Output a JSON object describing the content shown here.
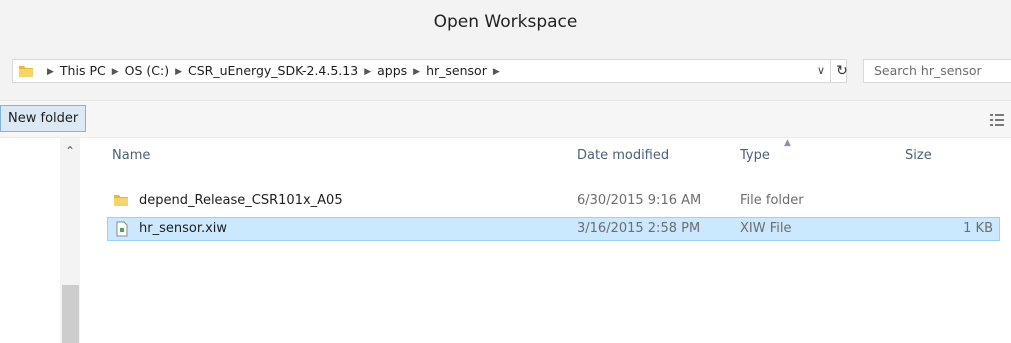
{
  "window": {
    "title": "Open Workspace"
  },
  "address_bar": {
    "crumbs": [
      "This PC",
      "OS (C:)",
      "CSR_uEnergy_SDK-2.4.5.13",
      "apps",
      "hr_sensor"
    ],
    "dropdown_glyph": "∨",
    "refresh_glyph": "↻"
  },
  "search": {
    "placeholder": "Search hr_sensor"
  },
  "toolbar": {
    "new_folder_label": "New folder"
  },
  "columns": {
    "name": "Name",
    "date_modified": "Date modified",
    "type": "Type",
    "size": "Size"
  },
  "files": [
    {
      "name": "depend_Release_CSR101x_A05",
      "date_modified": "6/30/2015 9:16 AM",
      "type": "File folder",
      "size": "",
      "icon": "folder-icon",
      "selected": false
    },
    {
      "name": "hr_sensor.xiw",
      "date_modified": "3/16/2015 2:58 PM",
      "type": "XIW File",
      "size": "1 KB",
      "icon": "file-icon",
      "selected": true
    }
  ],
  "colors": {
    "selection": "#cce8ff",
    "selection_border": "#99d1ff",
    "folder": "#e8b83b",
    "column_header": "#4c607a"
  }
}
